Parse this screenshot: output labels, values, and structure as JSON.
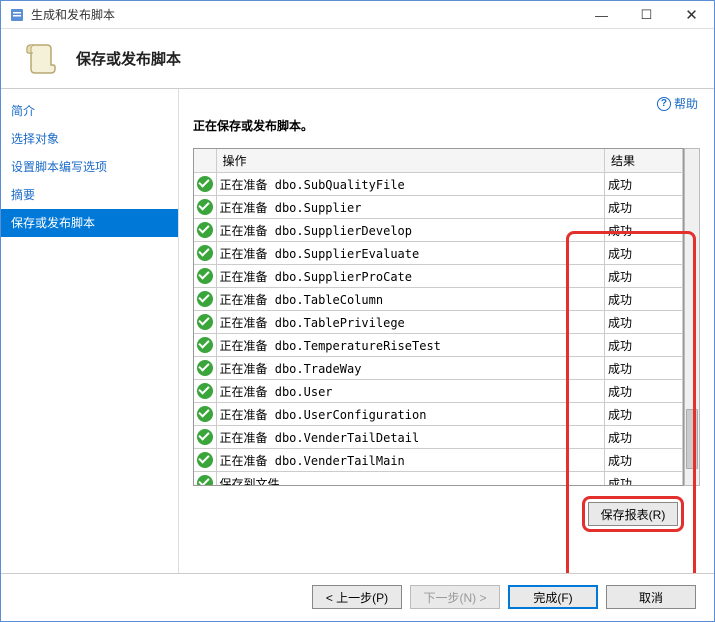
{
  "window": {
    "title": "生成和发布脚本",
    "minimize": "—",
    "maximize": "☐",
    "close": "✕"
  },
  "header": {
    "title": "保存或发布脚本"
  },
  "sidebar": {
    "items": [
      {
        "label": "简介"
      },
      {
        "label": "选择对象"
      },
      {
        "label": "设置脚本编写选项"
      },
      {
        "label": "摘要"
      },
      {
        "label": "保存或发布脚本"
      }
    ],
    "selectedIndex": 4
  },
  "help": {
    "label": "帮助"
  },
  "main": {
    "heading": "正在保存或发布脚本。",
    "columns": {
      "action": "操作",
      "result": "结果"
    },
    "rows": [
      {
        "action": "正在准备 dbo.SubQualityFile",
        "result": "成功"
      },
      {
        "action": "正在准备 dbo.Supplier",
        "result": "成功"
      },
      {
        "action": "正在准备 dbo.SupplierDevelop",
        "result": "成功"
      },
      {
        "action": "正在准备 dbo.SupplierEvaluate",
        "result": "成功"
      },
      {
        "action": "正在准备 dbo.SupplierProCate",
        "result": "成功"
      },
      {
        "action": "正在准备 dbo.TableColumn",
        "result": "成功"
      },
      {
        "action": "正在准备 dbo.TablePrivilege",
        "result": "成功"
      },
      {
        "action": "正在准备 dbo.TemperatureRiseTest",
        "result": "成功"
      },
      {
        "action": "正在准备 dbo.TradeWay",
        "result": "成功"
      },
      {
        "action": "正在准备 dbo.User",
        "result": "成功"
      },
      {
        "action": "正在准备 dbo.UserConfiguration",
        "result": "成功"
      },
      {
        "action": "正在准备 dbo.VenderTailDetail",
        "result": "成功"
      },
      {
        "action": "正在准备 dbo.VenderTailMain",
        "result": "成功"
      },
      {
        "action": "保存到文件",
        "result": "成功"
      }
    ],
    "saveReport": "保存报表(R)"
  },
  "footer": {
    "previous": "< 上一步(P)",
    "next": "下一步(N) >",
    "finish": "完成(F)",
    "cancel": "取消"
  }
}
